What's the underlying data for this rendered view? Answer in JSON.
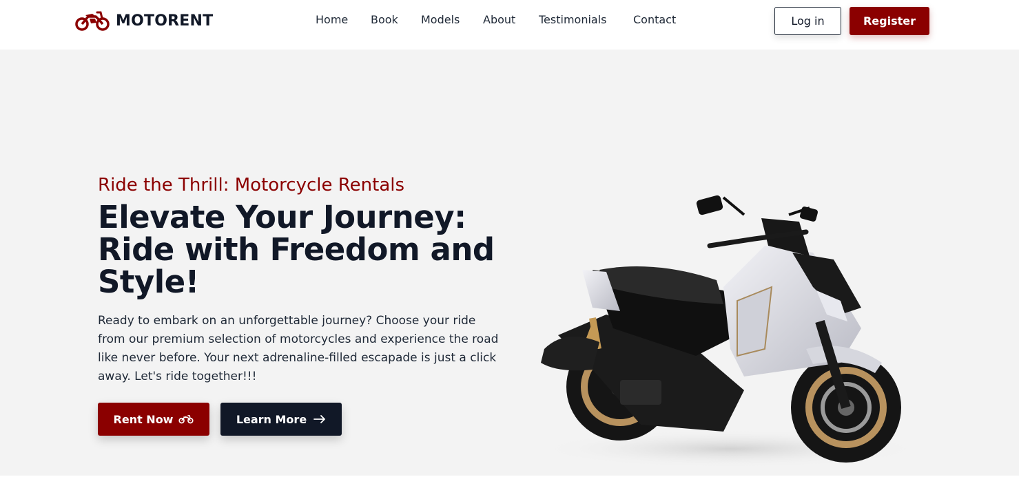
{
  "brand": {
    "name": "MOTORENT",
    "icon": "motorcycle-icon",
    "color": "#8b0000"
  },
  "nav": {
    "links": [
      {
        "label": "Home"
      },
      {
        "label": "Book"
      },
      {
        "label": "Models"
      },
      {
        "label": "About"
      },
      {
        "label": "Testimonials"
      },
      {
        "label": "Contact"
      }
    ],
    "login_label": "Log in",
    "register_label": "Register"
  },
  "hero": {
    "eyebrow": "Ride the Thrill: Motorcycle Rentals",
    "headline_line1": "Elevate Your Journey:",
    "headline_line2": "Ride with Freedom and",
    "headline_line3": "Style!",
    "lead": "Ready to embark on an unforgettable journey? Choose your ride from our premium selection of motorcycles and experience the road like never before. Your next adrenaline-filled escapade is just a click away. Let's ride together!!!",
    "rent_label": "Rent Now",
    "rent_icon": "motorcycle-icon",
    "learn_label": "Learn More",
    "learn_icon": "arrow-right-icon",
    "image": "scooter-image"
  },
  "colors": {
    "accent": "#8b0000",
    "dark": "#111827",
    "hero_bg": "#f3f3f3"
  }
}
